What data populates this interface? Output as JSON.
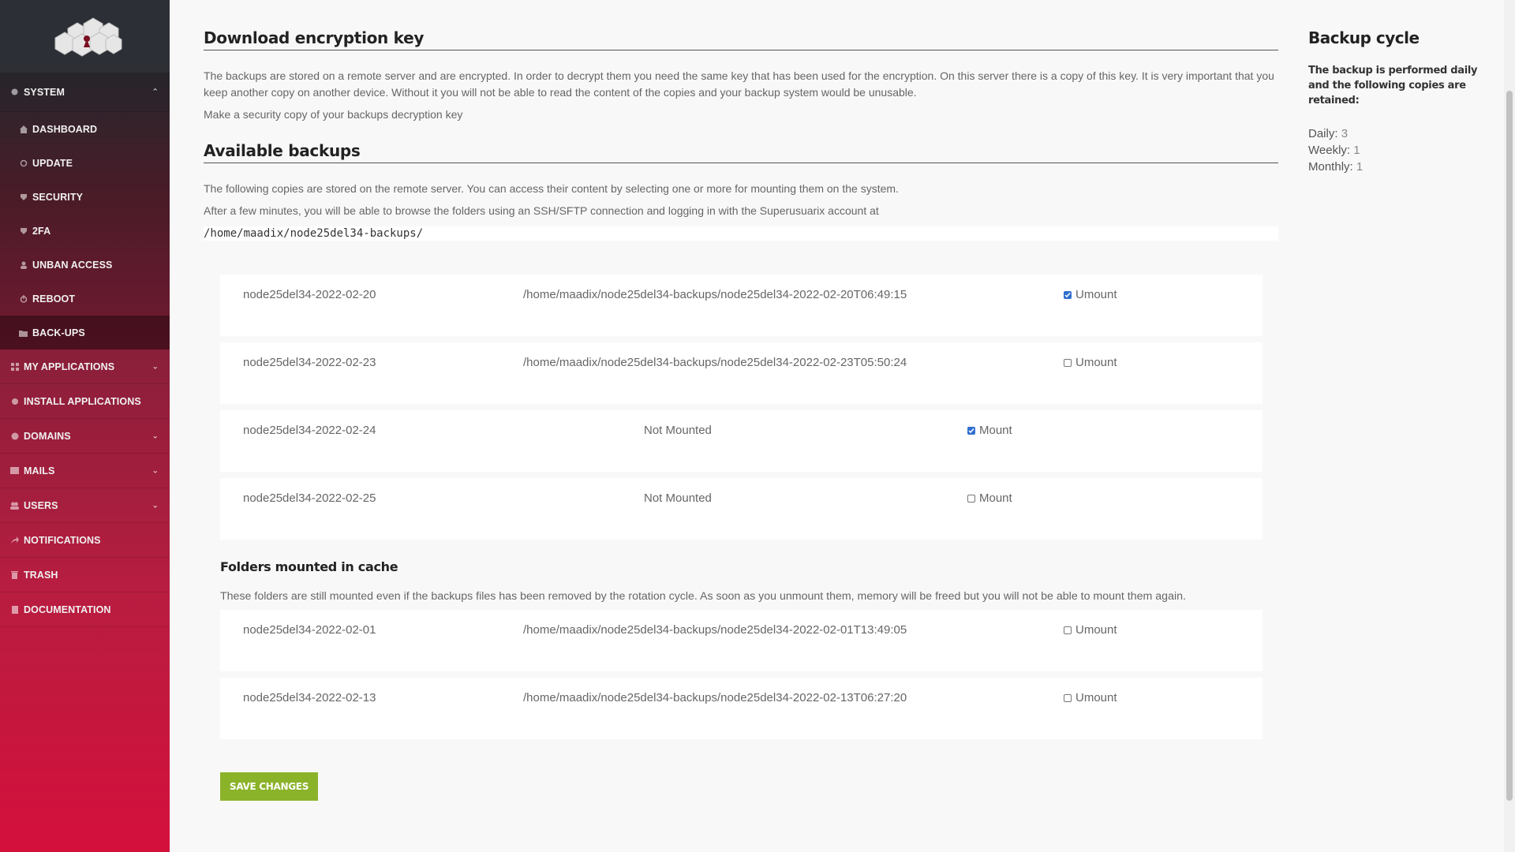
{
  "sidebar": {
    "system": "SYSTEM",
    "sub_items": [
      {
        "label": "DASHBOARD"
      },
      {
        "label": "UPDATE"
      },
      {
        "label": "SECURITY"
      },
      {
        "label": "2FA"
      },
      {
        "label": "UNBAN ACCESS"
      },
      {
        "label": "REBOOT"
      },
      {
        "label": "BACK-UPS"
      }
    ],
    "items": [
      {
        "label": "MY APPLICATIONS"
      },
      {
        "label": "INSTALL APPLICATIONS"
      },
      {
        "label": "DOMAINS"
      },
      {
        "label": "MAILS"
      },
      {
        "label": "USERS"
      },
      {
        "label": "NOTIFICATIONS"
      },
      {
        "label": "TRASH"
      },
      {
        "label": "DOCUMENTATION"
      }
    ]
  },
  "encryption": {
    "title": "Download encryption key",
    "description": "The backups are stored on a remote server and are encrypted. In order to decrypt them you need the same key that has been used for the encryption. On this server there is a copy of this key. It is very important that you keep another copy on another device. Without it you will not be able to read the content of the copies and your backup system would be unusable.",
    "link": "Make a security copy of your backups decryption key"
  },
  "backups": {
    "title": "Available backups",
    "line1": "The following copies are stored on the remote server. You can access their content by selecting one or more for mounting them on the system.",
    "line2": "After a few minutes, you will be able to browse the folders using an SSH/SFTP connection and logging in with the Superusuarix account at",
    "path": "/home/maadix/node25del34-backups/",
    "rows": [
      {
        "name": "node25del34-2022-02-20",
        "path": "/home/maadix/node25del34-backups/node25del34-2022-02-20T06:49:15",
        "action": "Umount",
        "checked": true
      },
      {
        "name": "node25del34-2022-02-23",
        "path": "/home/maadix/node25del34-backups/node25del34-2022-02-23T05:50:24",
        "action": "Umount",
        "checked": false
      },
      {
        "name": "node25del34-2022-02-24",
        "status": "Not Mounted",
        "action": "Mount",
        "checked": true
      },
      {
        "name": "node25del34-2022-02-25",
        "status": "Not Mounted",
        "action": "Mount",
        "checked": false
      }
    ]
  },
  "cache": {
    "title": "Folders mounted in cache",
    "description": "These folders are still mounted even if the backups files has been removed by the rotation cycle. As soon as you unmount them, memory will be freed but you will not be able to mount them again.",
    "rows": [
      {
        "name": "node25del34-2022-02-01",
        "path": "/home/maadix/node25del34-backups/node25del34-2022-02-01T13:49:05",
        "action": "Umount",
        "checked": false
      },
      {
        "name": "node25del34-2022-02-13",
        "path": "/home/maadix/node25del34-backups/node25del34-2022-02-13T06:27:20",
        "action": "Umount",
        "checked": false
      }
    ]
  },
  "save_label": "SAVE CHANGES",
  "cycle": {
    "title": "Backup cycle",
    "description": "The backup is performed daily and the following copies are retained:",
    "daily_label": "Daily:",
    "daily_value": "3",
    "weekly_label": "Weekly:",
    "weekly_value": "1",
    "monthly_label": "Monthly:",
    "monthly_value": "1"
  },
  "colors": {
    "accent_green": "#8bb32a",
    "sidebar_red": "#d4103c",
    "checkbox_blue": "#2f6fd0"
  }
}
